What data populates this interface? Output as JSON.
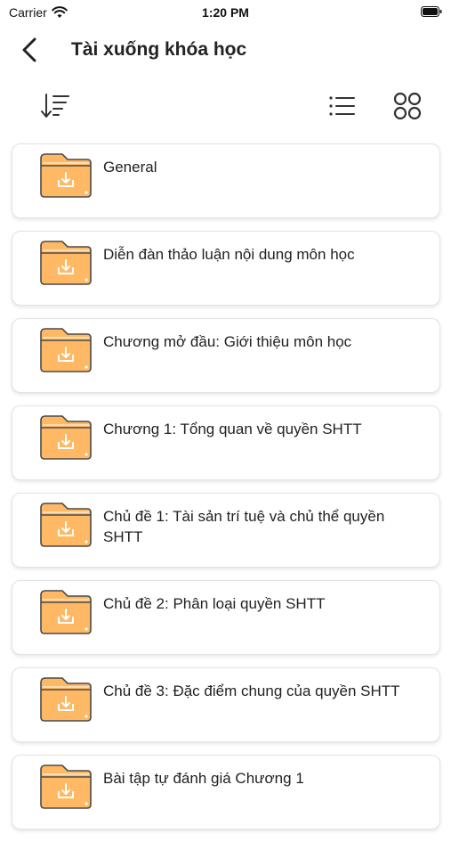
{
  "status_bar": {
    "carrier": "Carrier",
    "time": "1:20 PM",
    "icons": [
      "wifi-icon",
      "battery-icon"
    ]
  },
  "nav": {
    "title": "Tài xuống khóa học",
    "back_icon": "chevron-left-icon"
  },
  "toolbar": {
    "icons": [
      "sort-icon",
      "list-view-icon",
      "grid-view-icon"
    ]
  },
  "colors": {
    "folder_fill": "#FFB964",
    "folder_stroke": "#4A4A4A",
    "card_border": "#E3E3E3"
  },
  "items": [
    {
      "label": "General"
    },
    {
      "label": "Diễn đàn thảo luận nội dung môn học"
    },
    {
      "label": "Chương mở đầu: Giới thiệu môn học"
    },
    {
      "label": "Chương 1: Tổng quan về quyền SHTT"
    },
    {
      "label": "Chủ đề 1: Tài sản trí tuệ và chủ thể quyền SHTT"
    },
    {
      "label": "Chủ đề 2: Phân loại quyền SHTT"
    },
    {
      "label": "Chủ đề 3: Đặc điểm chung của quyền SHTT"
    },
    {
      "label": "Bài tập tự đánh giá Chương 1"
    }
  ]
}
